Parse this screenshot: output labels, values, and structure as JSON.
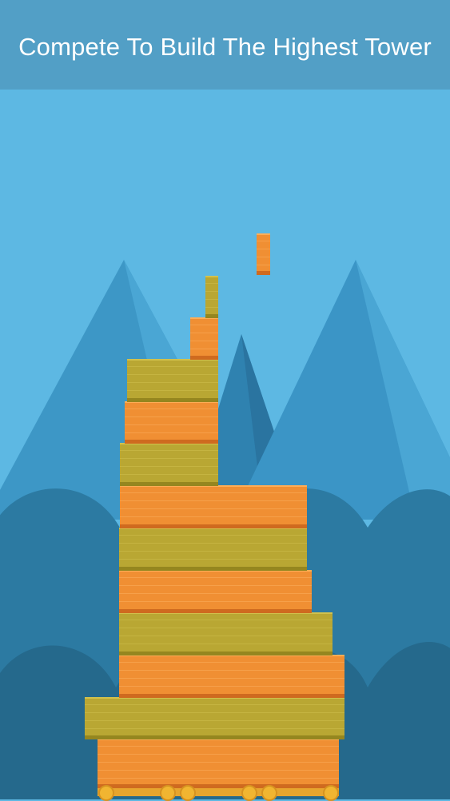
{
  "banner": {
    "title": "Compete To Build The Highest Tower"
  },
  "colors": {
    "banner_bg": "#529fc6",
    "sky": "#5db8e3",
    "mountain_light": "#4aa6d4",
    "mountain_mid": "#3b95c6",
    "mountain_dark": "#2f82b0",
    "hill_front": "#2c6f91",
    "hill_back": "#2d7aa0",
    "block_orange": "#f08f33",
    "block_olive": "#b9a733",
    "wheel": "#f1b531"
  },
  "tower": {
    "block_count": 13,
    "falling_block_color": "orange"
  }
}
